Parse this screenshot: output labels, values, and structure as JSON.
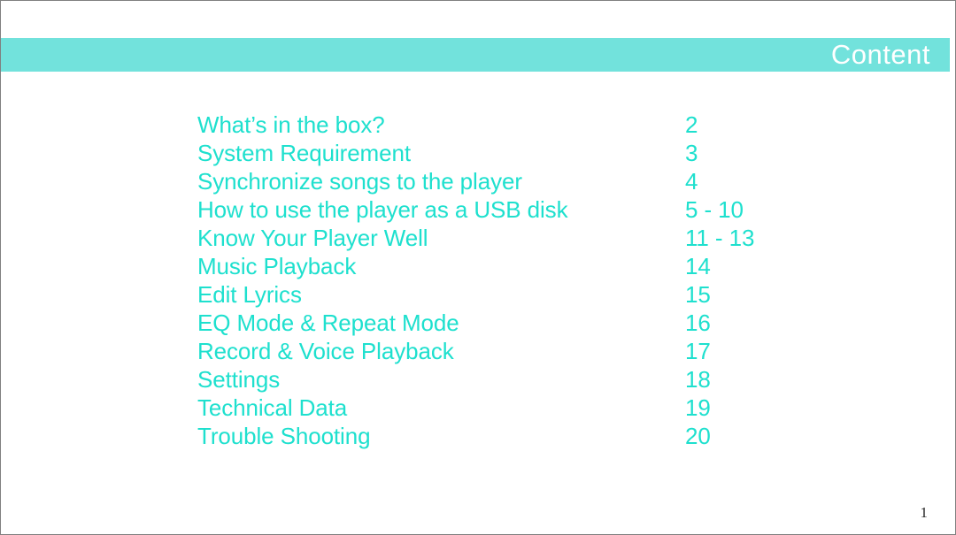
{
  "header": {
    "title": "Content",
    "band_color": "#72e2dc",
    "title_color": "#ffffff"
  },
  "toc": {
    "text_color": "#1ee0ce",
    "entries": [
      {
        "title": "What’s in the box?",
        "page": "2"
      },
      {
        "title": "System Requirement",
        "page": "3"
      },
      {
        "title": "Synchronize songs to the player",
        "page": "4"
      },
      {
        "title": "How to use the player as a USB disk",
        "page": "5 - 10"
      },
      {
        "title": "Know Your Player Well",
        "page": "11 - 13"
      },
      {
        "title": "Music Playback",
        "page": "14"
      },
      {
        "title": "Edit Lyrics",
        "page": "15"
      },
      {
        "title": "EQ Mode & Repeat Mode",
        "page": "16"
      },
      {
        "title": "Record & Voice Playback",
        "page": "17"
      },
      {
        "title": "Settings",
        "page": "18"
      },
      {
        "title": "Technical Data",
        "page": "19"
      },
      {
        "title": "Trouble Shooting",
        "page": "20"
      }
    ]
  },
  "footer": {
    "page_number": "1",
    "color": "#222222"
  }
}
